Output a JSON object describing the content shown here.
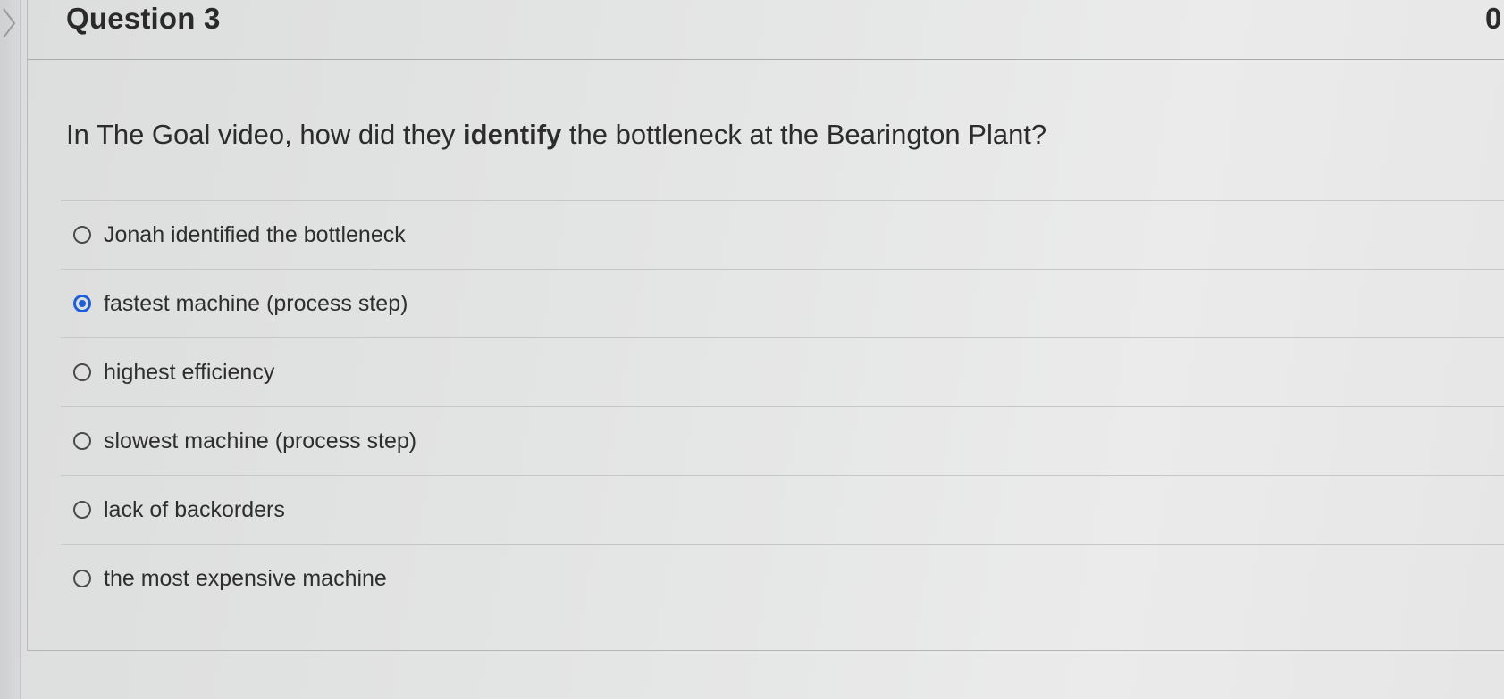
{
  "question": {
    "title": "Question 3",
    "points": "0",
    "prompt_before": "In The Goal video, how did they ",
    "prompt_bold": "identify",
    "prompt_after": " the bottleneck at the Bearington Plant?"
  },
  "choices": [
    {
      "label": "Jonah identified the bottleneck",
      "selected": false
    },
    {
      "label": "fastest machine (process step)",
      "selected": true
    },
    {
      "label": "highest efficiency",
      "selected": false
    },
    {
      "label": "slowest machine (process step)",
      "selected": false
    },
    {
      "label": "lack of backorders",
      "selected": false
    },
    {
      "label": "the most expensive machine",
      "selected": false
    }
  ],
  "colors": {
    "selected_radio": "#1d5fd6",
    "text": "#2c2c2c"
  },
  "icons": {
    "expand": "chevron-right-icon"
  }
}
